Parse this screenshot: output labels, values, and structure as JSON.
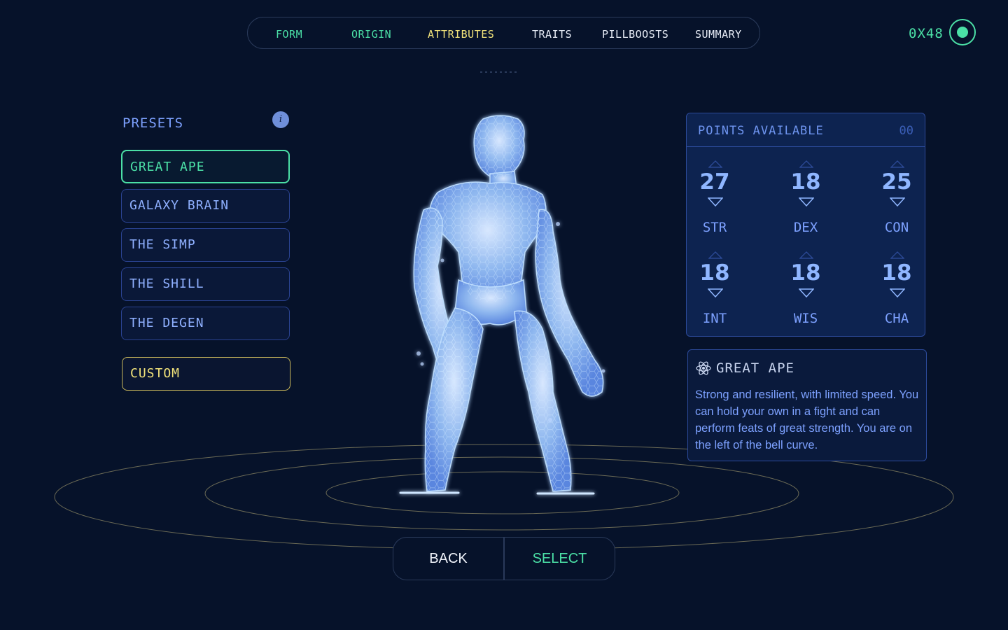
{
  "nav": {
    "items": [
      {
        "label": "FORM",
        "state": "done"
      },
      {
        "label": "ORIGIN",
        "state": "done"
      },
      {
        "label": "ATTRIBUTES",
        "state": "active"
      },
      {
        "label": "TRAITS",
        "state": "todo"
      },
      {
        "label": "PILLBOOSTS",
        "state": "todo"
      },
      {
        "label": "SUMMARY",
        "state": "todo"
      }
    ]
  },
  "wallet": {
    "address": "0X48",
    "status_color": "#4be0a6"
  },
  "presets": {
    "title": "PRESETS",
    "info_icon": "i",
    "items": [
      {
        "label": "GREAT APE",
        "selected": true
      },
      {
        "label": "GALAXY BRAIN",
        "selected": false
      },
      {
        "label": "THE SIMP",
        "selected": false
      },
      {
        "label": "THE SHILL",
        "selected": false
      },
      {
        "label": "THE DEGEN",
        "selected": false
      }
    ],
    "custom_label": "CUSTOM"
  },
  "points": {
    "label": "POINTS AVAILABLE",
    "value": "00",
    "stats": [
      {
        "name": "STR",
        "value": "27"
      },
      {
        "name": "DEX",
        "value": "18"
      },
      {
        "name": "CON",
        "value": "25"
      },
      {
        "name": "INT",
        "value": "18"
      },
      {
        "name": "WIS",
        "value": "18"
      },
      {
        "name": "CHA",
        "value": "18"
      }
    ]
  },
  "description": {
    "icon": "atom-icon",
    "title": "GREAT APE",
    "body": "Strong and resilient, with limited speed. You can hold your own in a fight and can perform feats of great strength. You are on the left of the bell curve."
  },
  "actions": {
    "back_label": "BACK",
    "select_label": "SELECT"
  },
  "colors": {
    "background": "#06122a",
    "accent_green": "#4be0a6",
    "accent_yellow": "#f2e37a",
    "panel_blue": "#0d2350"
  }
}
